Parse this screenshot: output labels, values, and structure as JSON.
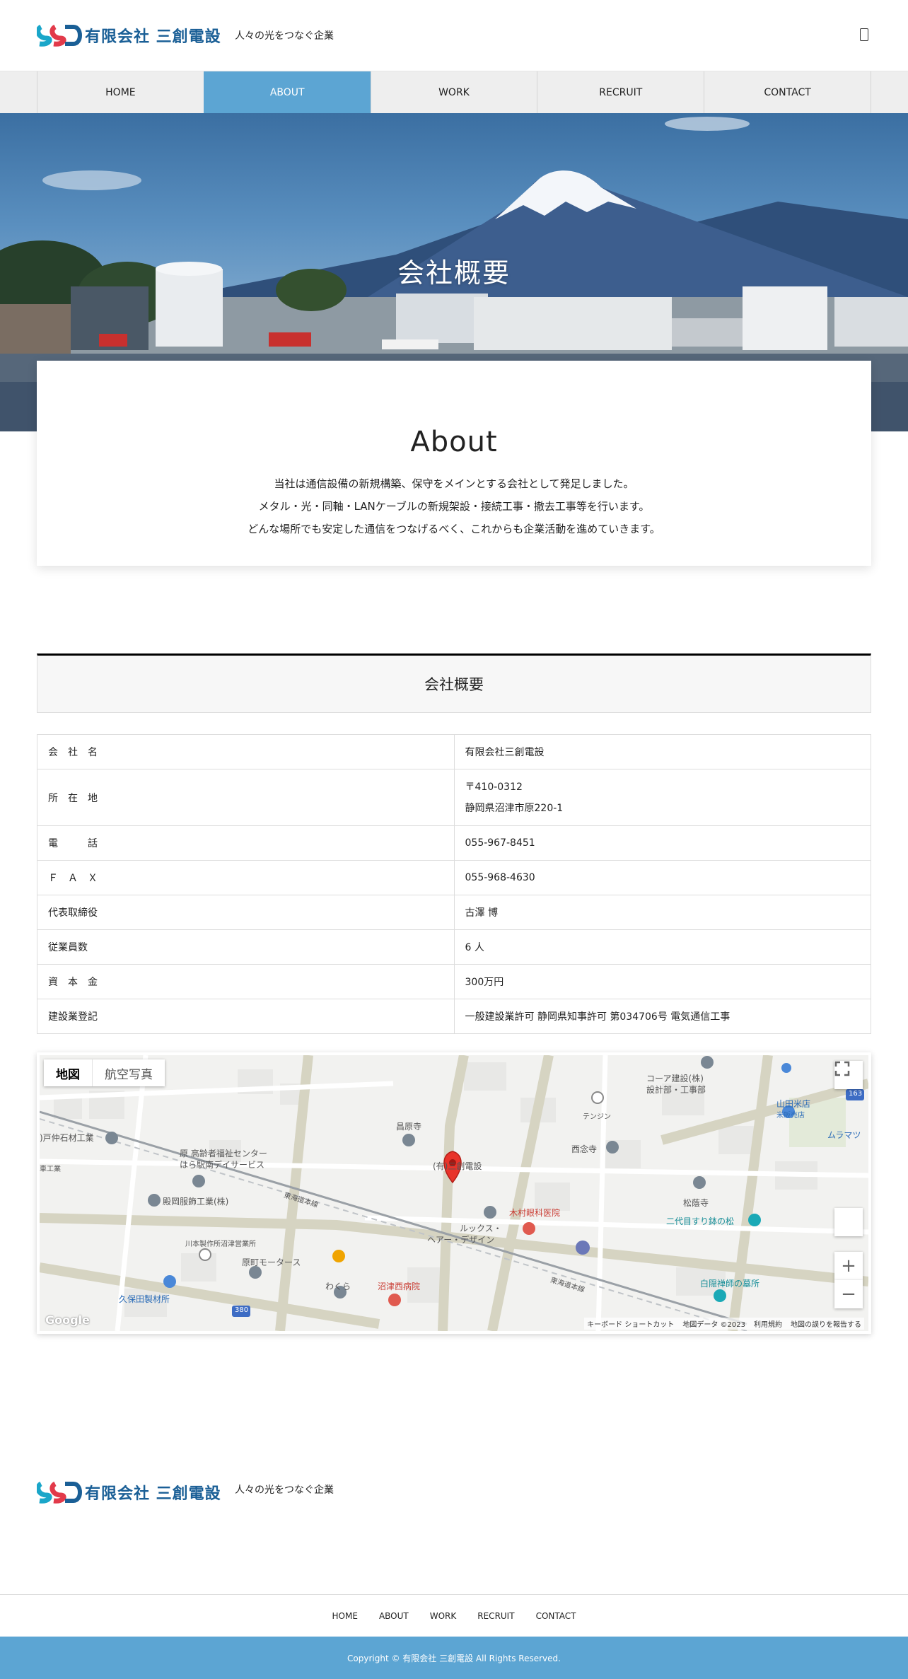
{
  "header": {
    "logo_text": "有限会社 三創電設",
    "tagline": "人々の光をつなぐ企業"
  },
  "nav": {
    "items": [
      {
        "label": "HOME"
      },
      {
        "label": "ABOUT"
      },
      {
        "label": "WORK"
      },
      {
        "label": "RECRUIT"
      },
      {
        "label": "CONTACT"
      }
    ],
    "active": "ABOUT"
  },
  "hero": {
    "title": "会社概要"
  },
  "about": {
    "heading": "About",
    "lines": [
      "当社は通信設備の新規構築、保守をメインとする会社として発足しました。",
      "メタル・光・同軸・LANケーブルの新規架設・接続工事・撤去工事等を行います。",
      "どんな場所でも安定した通信をつなげるべく、これからも企業活動を進めていきます。"
    ]
  },
  "company": {
    "title": "会社概要",
    "rows": [
      {
        "label": "会　社　名",
        "value": "有限会社三創電設"
      },
      {
        "label": "所　在　地",
        "value": "〒410-0312",
        "value2": "静岡県沼津市原220-1"
      },
      {
        "label": "電　　　話",
        "value": "055-967-8451"
      },
      {
        "label": "Ｆ　Ａ　Ｘ",
        "value": "055-968-4630"
      },
      {
        "label": "代表取締役",
        "value": "古澤 博"
      },
      {
        "label": "従業員数",
        "value": "6 人"
      },
      {
        "label": "資　本　金",
        "value": "300万円"
      },
      {
        "label": "建設業登記",
        "value": "一般建設業許可 静岡県知事許可 第034706号 電気通信工事"
      }
    ]
  },
  "map": {
    "type_map": "地図",
    "type_satellite": "航空写真",
    "labels": {
      "sanso": "(有)三創電設",
      "shogenji": "昌原寺",
      "koa": "コーア建設(株)",
      "koa2": "設計部・工事部",
      "tenjin": "テンジン",
      "saienji": "西念寺",
      "yamada": "山田米店",
      "yamada2": "米販売店",
      "murama": "ムラマツ",
      "tomatsu": ")戸仲石材工業",
      "hara_welfare": "原 高齢者福祉センター",
      "hara_day": "はら駅南デイサービス",
      "shuutetsu": "車工業",
      "tonooka": "殿岡服飾工業(株)",
      "tokaido1": "東海道本線",
      "kimura": "木村眼科医院",
      "lux": "ルックス・",
      "lux2": "ヘアー・デザイン",
      "shoin": "松蔭寺",
      "nidai": "二代目すり鉢の松",
      "kawamoto": "川本製作所沼津営業所",
      "haramachi": "原町モータース",
      "kubota": "久保田製材所",
      "wakura": "わくら",
      "numazu_west": "沼津西病院",
      "tokaido2": "東海道本線",
      "hakuin": "白隠禅師の墓所",
      "route380": "380",
      "route163": "163",
      "google": "Google",
      "shortcut": "キーボード ショートカット",
      "mapdata": "地図データ ©2023",
      "terms": "利用規約",
      "report": "地図の誤りを報告する"
    },
    "zoom_in": "+",
    "zoom_out": "−"
  },
  "footer": {
    "logo_text": "有限会社 三創電設",
    "tagline": "人々の光をつなぐ企業",
    "nav": [
      "HOME",
      "ABOUT",
      "WORK",
      "RECRUIT",
      "CONTACT"
    ],
    "copyright": "Copyright © 有限会社 三創電設 All Rights Reserved."
  },
  "colors": {
    "accent": "#5ca5d3",
    "logo_text": "#1a5f96"
  }
}
